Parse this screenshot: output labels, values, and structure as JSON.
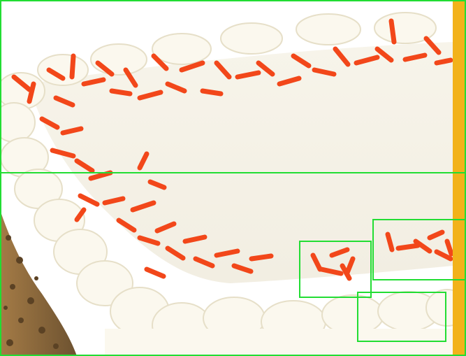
{
  "colors": {
    "box_stroke": "#22dd33",
    "side_strip": "#f2b21a",
    "frosting": "#fbf8ee",
    "frosting_shadow": "#e9e2cd",
    "carrot_shred": "#f2471a",
    "nut_crumb": "#8a6a3e"
  },
  "annotations": {
    "count": 6
  }
}
